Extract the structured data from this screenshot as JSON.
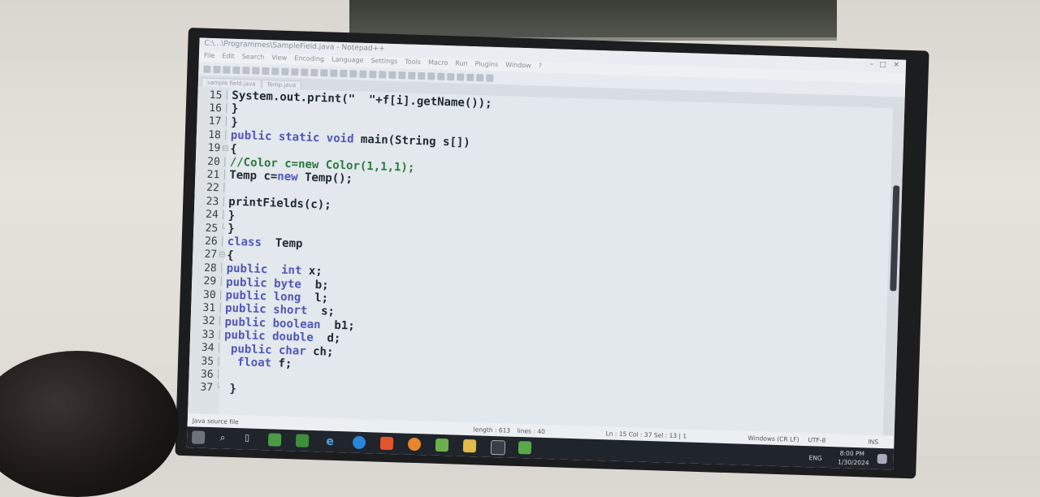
{
  "window": {
    "title": "C:\\...\\Programmes\\SampleField.java - Notepad++",
    "menu": [
      "File",
      "Edit",
      "Search",
      "View",
      "Encoding",
      "Language",
      "Settings",
      "Tools",
      "Macro",
      "Run",
      "Plugins",
      "Window",
      "?"
    ],
    "tabs": [
      "sample field.java",
      "Temp.java"
    ]
  },
  "editor": {
    "lines": [
      {
        "n": "15",
        "segs": [
          {
            "t": "System.out.print(\"  \"+f[i].getName());",
            "c": "tx"
          }
        ]
      },
      {
        "n": "16",
        "segs": [
          {
            "t": "}",
            "c": "tx"
          }
        ]
      },
      {
        "n": "17",
        "segs": [
          {
            "t": "}",
            "c": "tx"
          }
        ]
      },
      {
        "n": "18",
        "segs": [
          {
            "t": "public static void ",
            "c": "kw"
          },
          {
            "t": "main(String s[])",
            "c": "tx"
          }
        ]
      },
      {
        "n": "19",
        "segs": [
          {
            "t": "{",
            "c": "tx"
          }
        ]
      },
      {
        "n": "20",
        "segs": [
          {
            "t": "//Color c=new Color(1,1,1);",
            "c": "cm"
          }
        ]
      },
      {
        "n": "21",
        "segs": [
          {
            "t": "Temp c=",
            "c": "tx"
          },
          {
            "t": "new ",
            "c": "kw"
          },
          {
            "t": "Temp();",
            "c": "tx"
          }
        ]
      },
      {
        "n": "22",
        "segs": []
      },
      {
        "n": "23",
        "segs": [
          {
            "t": "printFields(c);",
            "c": "tx"
          }
        ]
      },
      {
        "n": "24",
        "segs": [
          {
            "t": "}",
            "c": "tx"
          }
        ]
      },
      {
        "n": "25",
        "segs": [
          {
            "t": "}",
            "c": "tx"
          }
        ]
      },
      {
        "n": "26",
        "segs": [
          {
            "t": "class ",
            "c": "kw"
          },
          {
            "t": " Temp",
            "c": "tx"
          }
        ]
      },
      {
        "n": "27",
        "segs": [
          {
            "t": "{",
            "c": "tx"
          }
        ]
      },
      {
        "n": "28",
        "segs": [
          {
            "t": "public ",
            "c": "kw"
          },
          {
            "t": " int ",
            "c": "kw"
          },
          {
            "t": "x;",
            "c": "tx"
          }
        ]
      },
      {
        "n": "29",
        "segs": [
          {
            "t": "public byte ",
            "c": "kw"
          },
          {
            "t": " b;",
            "c": "tx"
          }
        ]
      },
      {
        "n": "30",
        "segs": [
          {
            "t": "public long ",
            "c": "kw"
          },
          {
            "t": " l;",
            "c": "tx"
          }
        ]
      },
      {
        "n": "31",
        "segs": [
          {
            "t": "public short ",
            "c": "kw"
          },
          {
            "t": " s;",
            "c": "tx"
          }
        ]
      },
      {
        "n": "32",
        "segs": [
          {
            "t": "public boolean ",
            "c": "kw"
          },
          {
            "t": " b1;",
            "c": "tx"
          }
        ]
      },
      {
        "n": "33",
        "segs": [
          {
            "t": "public double ",
            "c": "kw"
          },
          {
            "t": " d;",
            "c": "tx"
          }
        ]
      },
      {
        "n": "34",
        "segs": [
          {
            "t": " public char ",
            "c": "kw"
          },
          {
            "t": "ch;",
            "c": "tx"
          }
        ]
      },
      {
        "n": "35",
        "segs": [
          {
            "t": "  float ",
            "c": "kw"
          },
          {
            "t": "f;",
            "c": "tx"
          }
        ]
      },
      {
        "n": "36",
        "segs": []
      },
      {
        "n": "37",
        "segs": [
          {
            "t": " }",
            "c": "tx"
          }
        ]
      }
    ]
  },
  "status": {
    "file_type": "Java source file",
    "length": "length : 613",
    "lines": "lines : 40",
    "position": "Ln : 15    Col : 37    Sel : 13 | 1",
    "eol": "Windows (CR LF)",
    "encoding": "UTF-8",
    "mode": "INS"
  },
  "taskbar": {
    "language": "ENG",
    "time": "8:00 PM",
    "date": "1/30/2024"
  },
  "colors": {
    "keyword": "#4f57b8",
    "text": "#1f2a30",
    "comment": "#2a7a3c"
  }
}
